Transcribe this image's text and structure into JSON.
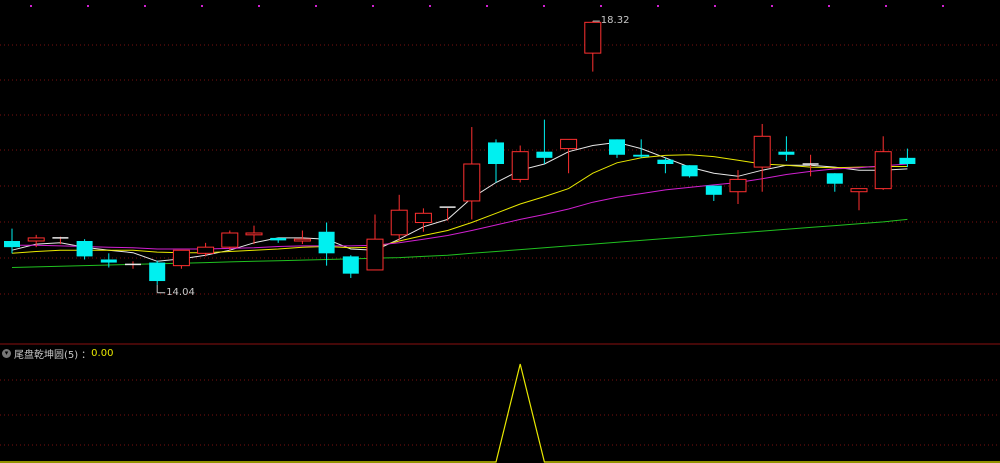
{
  "indicator": {
    "name": "尾盘乾坤圆(5)",
    "sep": "：",
    "value": "0.00"
  },
  "chart_data": {
    "type": "candlestick",
    "ylim": [
      13.5,
      18.5
    ],
    "indicator_ylim": [
      0,
      1
    ],
    "candles": [
      {
        "o": 14.75,
        "h": 14.95,
        "l": 14.55,
        "c": 14.65
      },
      {
        "o": 14.75,
        "h": 14.85,
        "l": 14.65,
        "c": 14.8
      },
      {
        "o": 14.8,
        "h": 14.82,
        "l": 14.7,
        "c": 14.8
      },
      {
        "o": 14.75,
        "h": 14.78,
        "l": 14.45,
        "c": 14.5
      },
      {
        "o": 14.45,
        "h": 14.55,
        "l": 14.32,
        "c": 14.4
      },
      {
        "o": 14.35,
        "h": 14.42,
        "l": 14.3,
        "c": 14.37
      },
      {
        "o": 14.4,
        "h": 14.43,
        "l": 14.04,
        "c": 14.1
      },
      {
        "o": 14.35,
        "h": 14.58,
        "l": 14.3,
        "c": 14.6
      },
      {
        "o": 14.55,
        "h": 14.72,
        "l": 14.5,
        "c": 14.65
      },
      {
        "o": 14.65,
        "h": 14.92,
        "l": 14.6,
        "c": 14.88
      },
      {
        "o": 14.85,
        "h": 15.0,
        "l": 14.7,
        "c": 14.88
      },
      {
        "o": 14.8,
        "h": 14.8,
        "l": 14.72,
        "c": 14.76
      },
      {
        "o": 14.75,
        "h": 14.92,
        "l": 14.7,
        "c": 14.78
      },
      {
        "o": 14.9,
        "h": 15.05,
        "l": 14.35,
        "c": 14.55
      },
      {
        "o": 14.5,
        "h": 14.52,
        "l": 14.15,
        "c": 14.22
      },
      {
        "o": 14.28,
        "h": 15.18,
        "l": 14.28,
        "c": 14.78
      },
      {
        "o": 14.85,
        "h": 15.5,
        "l": 14.75,
        "c": 15.25
      },
      {
        "o": 15.05,
        "h": 15.28,
        "l": 14.9,
        "c": 15.2
      },
      {
        "o": 15.28,
        "h": 15.28,
        "l": 15.08,
        "c": 15.3
      },
      {
        "o": 15.4,
        "h": 16.6,
        "l": 15.1,
        "c": 16.0
      },
      {
        "o": 16.35,
        "h": 16.4,
        "l": 15.7,
        "c": 16.0
      },
      {
        "o": 15.75,
        "h": 16.3,
        "l": 15.7,
        "c": 16.2
      },
      {
        "o": 16.2,
        "h": 16.72,
        "l": 16.0,
        "c": 16.1
      },
      {
        "o": 16.25,
        "h": 16.4,
        "l": 15.85,
        "c": 16.4
      },
      {
        "o": 17.8,
        "h": 18.32,
        "l": 17.5,
        "c": 18.3
      },
      {
        "o": 16.4,
        "h": 16.4,
        "l": 16.1,
        "c": 16.15
      },
      {
        "o": 16.15,
        "h": 16.4,
        "l": 16.1,
        "c": 16.12
      },
      {
        "o": 16.07,
        "h": 16.1,
        "l": 15.85,
        "c": 16.0
      },
      {
        "o": 15.98,
        "h": 15.98,
        "l": 15.78,
        "c": 15.8
      },
      {
        "o": 15.65,
        "h": 15.65,
        "l": 15.4,
        "c": 15.5
      },
      {
        "o": 15.55,
        "h": 15.9,
        "l": 15.35,
        "c": 15.75
      },
      {
        "o": 15.95,
        "h": 16.65,
        "l": 15.55,
        "c": 16.45
      },
      {
        "o": 16.2,
        "h": 16.45,
        "l": 16.05,
        "c": 16.15
      },
      {
        "o": 15.98,
        "h": 16.15,
        "l": 15.8,
        "c": 16.0
      },
      {
        "o": 15.85,
        "h": 15.85,
        "l": 15.55,
        "c": 15.68
      },
      {
        "o": 15.55,
        "h": 15.6,
        "l": 15.25,
        "c": 15.6
      },
      {
        "o": 15.6,
        "h": 16.45,
        "l": 15.58,
        "c": 16.2
      },
      {
        "o": 16.1,
        "h": 16.25,
        "l": 15.95,
        "c": 16.0
      }
    ],
    "ma": [
      {
        "color": "#e8e8e8",
        "values": [
          14.6,
          14.7,
          14.72,
          14.65,
          14.6,
          14.56,
          14.42,
          14.46,
          14.52,
          14.6,
          14.72,
          14.8,
          14.8,
          14.78,
          14.62,
          14.6,
          14.78,
          14.98,
          15.1,
          15.45,
          15.7,
          15.9,
          16.0,
          16.2,
          16.3,
          16.35,
          16.25,
          16.1,
          15.95,
          15.85,
          15.8,
          15.9,
          15.98,
          15.98,
          15.95,
          15.9,
          15.9,
          15.92
        ]
      },
      {
        "color": "#e8e800",
        "values": [
          14.55,
          14.58,
          14.6,
          14.6,
          14.6,
          14.6,
          14.57,
          14.56,
          14.56,
          14.58,
          14.6,
          14.62,
          14.65,
          14.66,
          14.64,
          14.65,
          14.75,
          14.84,
          14.92,
          15.05,
          15.2,
          15.35,
          15.47,
          15.6,
          15.85,
          16.02,
          16.1,
          16.14,
          16.15,
          16.12,
          16.06,
          16.0,
          15.98,
          15.95,
          15.94,
          15.95,
          15.96,
          15.96
        ]
      },
      {
        "color": "#d020d0",
        "values": [
          14.68,
          14.68,
          14.67,
          14.66,
          14.65,
          14.64,
          14.62,
          14.62,
          14.62,
          14.63,
          14.64,
          14.66,
          14.67,
          14.67,
          14.67,
          14.68,
          14.72,
          14.78,
          14.84,
          14.92,
          15.01,
          15.1,
          15.18,
          15.27,
          15.38,
          15.46,
          15.52,
          15.58,
          15.62,
          15.66,
          15.7,
          15.76,
          15.83,
          15.88,
          15.92,
          15.94,
          15.97,
          16.0
        ]
      },
      {
        "color": "#20c020",
        "values": [
          14.32,
          14.33,
          14.34,
          14.35,
          14.36,
          14.37,
          14.38,
          14.39,
          14.4,
          14.41,
          14.42,
          14.43,
          14.44,
          14.45,
          14.46,
          14.47,
          14.48,
          14.5,
          14.52,
          14.55,
          14.58,
          14.61,
          14.64,
          14.67,
          14.7,
          14.73,
          14.76,
          14.79,
          14.82,
          14.85,
          14.88,
          14.91,
          14.94,
          14.97,
          15.0,
          15.03,
          15.06,
          15.1
        ]
      }
    ],
    "high_label": "18.32",
    "low_label": "14.04",
    "indicator_values": [
      0,
      0,
      0,
      0,
      0,
      0,
      0,
      0,
      0,
      0,
      0,
      0,
      0,
      0,
      0,
      0,
      0,
      0,
      0,
      0,
      0,
      1,
      0,
      0,
      0,
      0,
      0,
      0,
      0,
      0,
      0,
      0,
      0,
      0,
      0,
      0,
      0,
      0
    ]
  }
}
